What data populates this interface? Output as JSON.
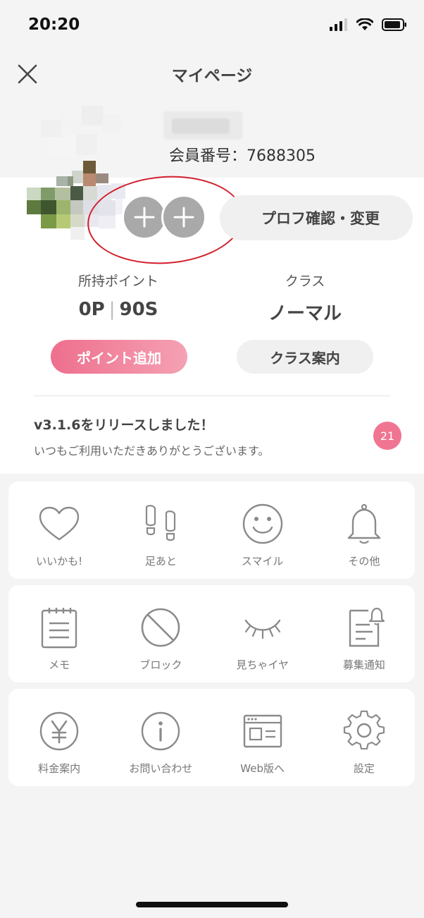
{
  "status_bar": {
    "time": "20:20"
  },
  "header": {
    "title": "マイページ"
  },
  "profile": {
    "member_number": "会員番号：7688305",
    "edit_button_label": "プロフ確認・変更"
  },
  "stats": {
    "points_label": "所持ポイント",
    "points_p": "0P",
    "points_sep": "|",
    "points_s": "90S",
    "class_label": "クラス",
    "class_value": "ノーマル"
  },
  "buttons": {
    "add_points": "ポイント追加",
    "class_guide": "クラス案内"
  },
  "news": {
    "title": "v3.1.6をリリースしました！",
    "body": "いつもご利用いただきありがとうございます。",
    "badge_count": "21"
  },
  "grid_row1": [
    {
      "label": "いいかも!",
      "icon": "heart-icon"
    },
    {
      "label": "足あと",
      "icon": "footprints-icon"
    },
    {
      "label": "スマイル",
      "icon": "smile-icon"
    },
    {
      "label": "その他",
      "icon": "bell-icon"
    }
  ],
  "grid_row2": [
    {
      "label": "メモ",
      "icon": "memo-icon"
    },
    {
      "label": "ブロック",
      "icon": "block-icon"
    },
    {
      "label": "見ちゃイヤ",
      "icon": "closed-eye-icon"
    },
    {
      "label": "募集通知",
      "icon": "notice-board-icon"
    }
  ],
  "grid_row3": [
    {
      "label": "料金案内",
      "icon": "yen-icon"
    },
    {
      "label": "お問い合わせ",
      "icon": "info-icon"
    },
    {
      "label": "Web版へ",
      "icon": "browser-icon"
    },
    {
      "label": "設定",
      "icon": "gear-icon"
    }
  ],
  "colors": {
    "accent_pink": "#ee6f8d",
    "badge_pink": "#f07592",
    "annotation_red": "#d21f2b",
    "icon_gray": "#8a8a8a"
  }
}
